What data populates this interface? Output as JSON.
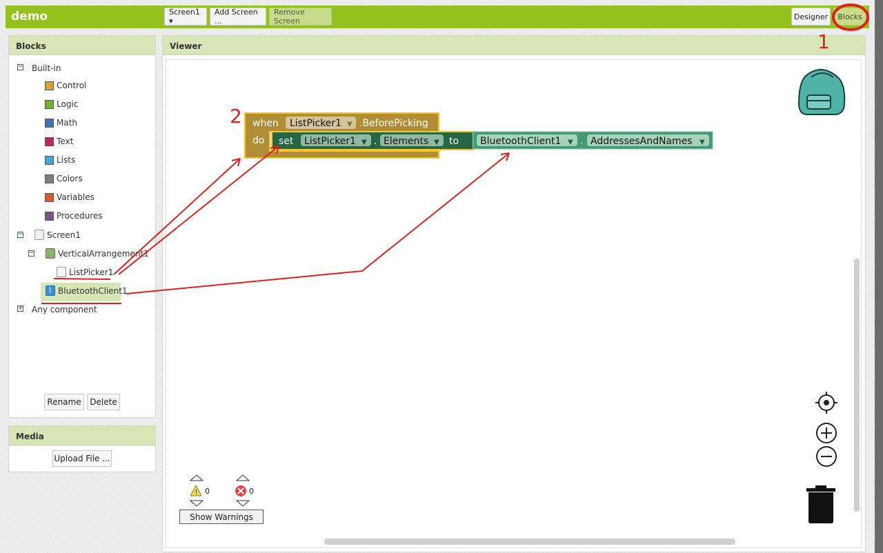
{
  "app": {
    "title": "demo"
  },
  "toolbar": {
    "screen_select": "Screen1 ▾",
    "add_screen": "Add Screen ...",
    "remove_screen": "Remove Screen",
    "designer": "Designer",
    "blocks": "Blocks"
  },
  "blocks_panel": {
    "title": "Blocks",
    "builtin_label": "Built-in",
    "builtin": [
      {
        "label": "Control",
        "color": "#d7a13a"
      },
      {
        "label": "Logic",
        "color": "#77ab41"
      },
      {
        "label": "Math",
        "color": "#3f71b5"
      },
      {
        "label": "Text",
        "color": "#b32d5e"
      },
      {
        "label": "Lists",
        "color": "#49a6d4"
      },
      {
        "label": "Colors",
        "color": "#7d7d7d"
      },
      {
        "label": "Variables",
        "color": "#d05f2d"
      },
      {
        "label": "Procedures",
        "color": "#7c5385"
      }
    ],
    "screen_label": "Screen1",
    "arrangement_label": "VerticalArrangement1",
    "listpicker_label": "ListPicker1",
    "bluetooth_label": "BluetoothClient1",
    "any_component_label": "Any component",
    "rename": "Rename",
    "delete": "Delete"
  },
  "media_panel": {
    "title": "Media",
    "upload": "Upload File ..."
  },
  "viewer": {
    "title": "Viewer",
    "event_block": {
      "when": "when",
      "component": "ListPicker1",
      "event": ".BeforePicking",
      "do": "do"
    },
    "set_block": {
      "set": "set",
      "component": "ListPicker1",
      "dot": ".",
      "property": "Elements",
      "to": "to"
    },
    "getter_block": {
      "component": "BluetoothClient1",
      "dot": ".",
      "property": "AddressesAndNames"
    },
    "warnings_count": "0",
    "errors_count": "0",
    "show_warnings": "Show Warnings"
  },
  "annotations": {
    "label_1": "1",
    "label_2": "2"
  },
  "colors": {
    "topbar": "#95c11f",
    "panel_header": "#d6e6b6",
    "event_block": "#b18e35",
    "set_block": "#266643",
    "getter_block": "#439970",
    "annotation_red": "#e0201a"
  }
}
